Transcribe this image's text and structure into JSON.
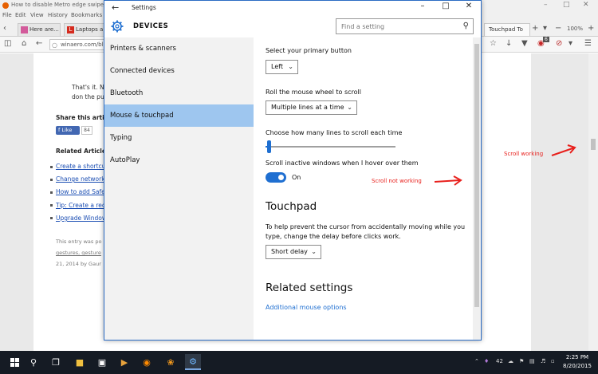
{
  "browser": {
    "window_title": "How to disable Metro edge swipes and...",
    "menu": [
      "File",
      "Edit",
      "View",
      "History",
      "Bookmarks"
    ],
    "tabs": [
      {
        "label": "Here are..."
      },
      {
        "label": "Laptops a..."
      },
      {
        "label": "Touchpad To"
      }
    ],
    "zoom": "100%",
    "address": "winaero.com/bl",
    "badge_count": "6",
    "page": {
      "text_line1": "That's it. N",
      "text_line2": "don the pu",
      "share_heading": "Share this artic",
      "fb_like": "Like",
      "fb_count": "84",
      "related_heading": "Related Article",
      "related_links": [
        "Create a shortcu",
        "Change network",
        "How to add Safe",
        "Tip: Create a rec",
        "Upgrade Window"
      ],
      "footer_line1": "This entry was po",
      "footer_line2": "gestures, gesture",
      "footer_line3": "21, 2014 by Gaur"
    }
  },
  "settings": {
    "window_title": "Settings",
    "section": "DEVICES",
    "search_placeholder": "Find a setting",
    "sidebar": [
      {
        "label": "Printers & scanners"
      },
      {
        "label": "Connected devices"
      },
      {
        "label": "Bluetooth"
      },
      {
        "label": "Mouse & touchpad"
      },
      {
        "label": "Typing"
      },
      {
        "label": "AutoPlay"
      }
    ],
    "selected_item": "Mouse & touchpad",
    "content": {
      "primary_button_label": "Select your primary button",
      "primary_button_value": "Left",
      "roll_label": "Roll the mouse wheel to scroll",
      "roll_value": "Multiple lines at a time",
      "lines_label": "Choose how many lines to scroll each time",
      "lines_value_fraction": 0.03,
      "inactive_label": "Scroll inactive windows when I hover over them",
      "inactive_state": "On",
      "touchpad_heading": "Touchpad",
      "touchpad_desc": "To help prevent the cursor from accidentally moving while you type, change the delay before clicks work.",
      "delay_value": "Short delay",
      "related_heading": "Related settings",
      "related_link": "Additional mouse options"
    }
  },
  "annotations": {
    "scroll_not_working": "Scroll not working",
    "scroll_working": "Scroll working"
  },
  "taskbar": {
    "tray_number": "42",
    "time": "2:25 PM",
    "date": "8/20/2015"
  },
  "colors": {
    "accent": "#1f6fd1",
    "selected_bg": "#9ec6ef",
    "annotation": "#e8201c",
    "taskbar": "#151b24"
  }
}
